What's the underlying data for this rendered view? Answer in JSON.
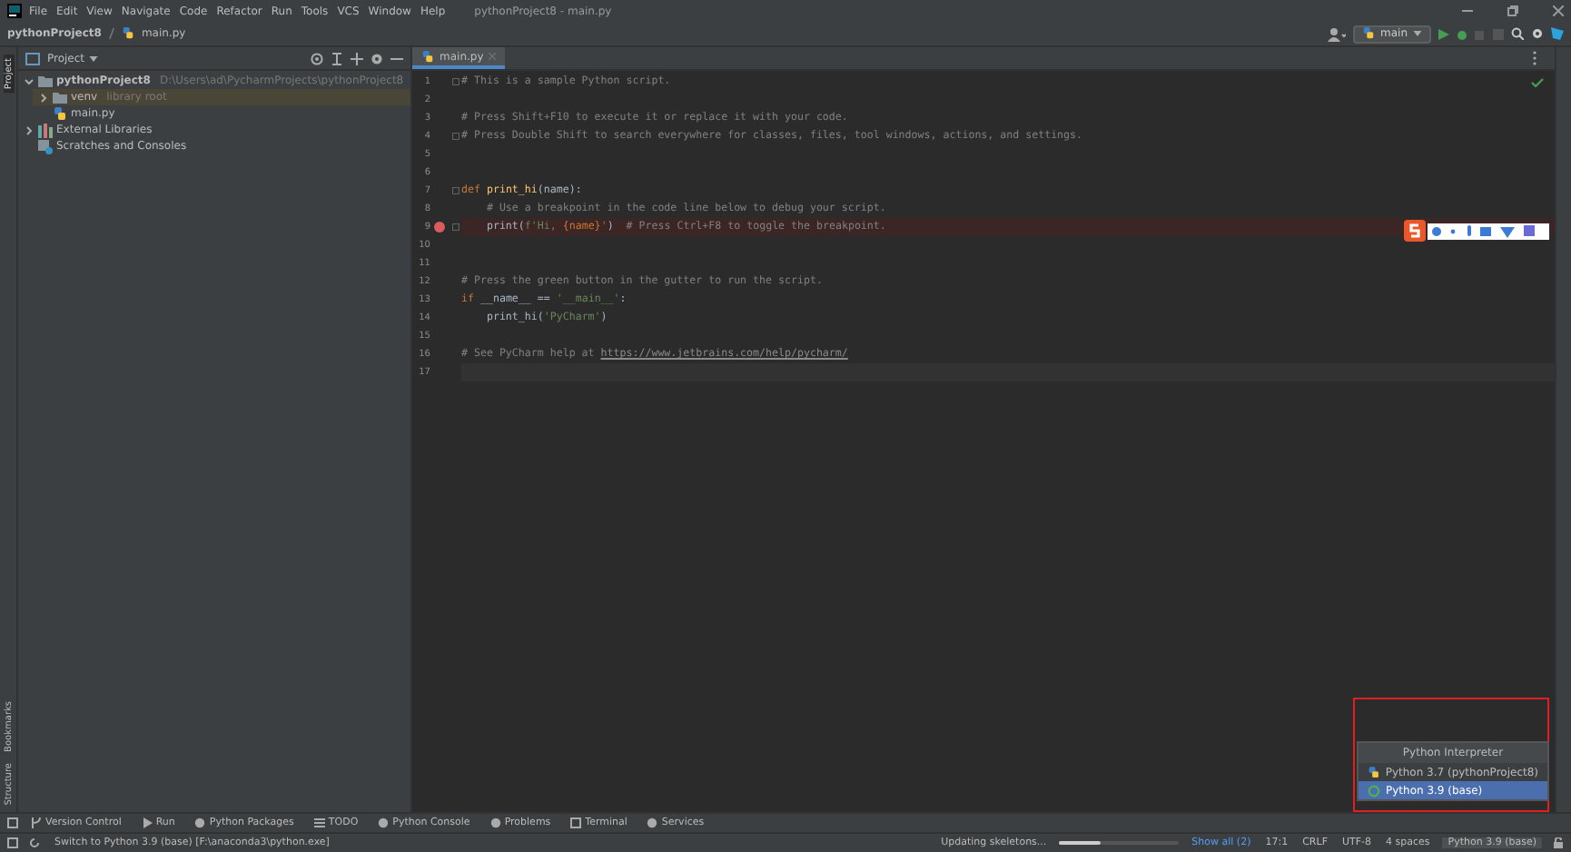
{
  "menu": [
    "File",
    "Edit",
    "View",
    "Navigate",
    "Code",
    "Refactor",
    "Run",
    "Tools",
    "VCS",
    "Window",
    "Help"
  ],
  "window_title": "pythonProject8 - main.py",
  "breadcrumb": [
    "pythonProject8",
    "main.py"
  ],
  "run_config": "main",
  "side_tabs": {
    "top": [
      {
        "label": "Project",
        "selected": true
      }
    ],
    "bottom": [
      {
        "label": "Bookmarks",
        "selected": false
      },
      {
        "label": "Structure",
        "selected": false
      }
    ]
  },
  "project_panel": {
    "title": "Project",
    "tree": [
      {
        "label": "pythonProject8",
        "hint": "D:\\Users\\ad\\PycharmProjects\\pythonProject8",
        "kind": "folder",
        "expanded": true,
        "selected": false,
        "children": [
          {
            "label": "venv",
            "hint": "library root",
            "kind": "folder",
            "expanded": false,
            "selected": true
          },
          {
            "label": "main.py",
            "kind": "python",
            "selected": false
          }
        ]
      },
      {
        "label": "External Libraries",
        "kind": "library",
        "expanded": false,
        "selected": false
      },
      {
        "label": "Scratches and Consoles",
        "kind": "scratch",
        "selected": false
      }
    ]
  },
  "editor": {
    "tab": "main.py",
    "lines": [
      {
        "number": "1",
        "fold": true,
        "tokens": [
          {
            "kind": "comment",
            "text": "# This is a sample Python script."
          }
        ]
      },
      {
        "number": "2"
      },
      {
        "number": "3",
        "tokens": [
          {
            "kind": "comment",
            "text": "# Press Shift+F10 to execute it or replace it with your code."
          }
        ]
      },
      {
        "number": "4",
        "fold": true,
        "tokens": [
          {
            "kind": "comment",
            "text": "# Press Double Shift to search everywhere for classes, files, tool windows, actions, and settings."
          }
        ]
      },
      {
        "number": "5"
      },
      {
        "number": "6"
      },
      {
        "number": "7",
        "fold": true,
        "tokens": [
          {
            "kind": "keyword",
            "text": "def "
          },
          {
            "kind": "fn",
            "text": "print_hi"
          },
          {
            "kind": "plain",
            "text": "(name):"
          }
        ]
      },
      {
        "number": "8",
        "tokens": [
          {
            "kind": "comment",
            "text": "    # Use a breakpoint in the code line below to debug your script."
          }
        ]
      },
      {
        "number": "9",
        "breakpoint": true,
        "fold": true,
        "tokens": [
          {
            "kind": "plain",
            "text": "    print("
          },
          {
            "kind": "str",
            "text": "f'Hi, "
          },
          {
            "kind": "keyword",
            "text": "{name}"
          },
          {
            "kind": "str",
            "text": "'"
          },
          {
            "kind": "plain",
            "text": ")  "
          },
          {
            "kind": "comment",
            "text": "# Press Ctrl+F8 to toggle the breakpoint."
          }
        ]
      },
      {
        "number": "10"
      },
      {
        "number": "11"
      },
      {
        "number": "12",
        "tokens": [
          {
            "kind": "comment",
            "text": "# Press the green button in the gutter to run the script."
          }
        ]
      },
      {
        "number": "13",
        "tokens": [
          {
            "kind": "keyword",
            "text": "if "
          },
          {
            "kind": "plain",
            "text": "__name__ == "
          },
          {
            "kind": "str",
            "text": "'__main__'"
          },
          {
            "kind": "plain",
            "text": ":"
          }
        ]
      },
      {
        "number": "14",
        "tokens": [
          {
            "kind": "plain",
            "text": "    print_hi("
          },
          {
            "kind": "str",
            "text": "'PyCharm'"
          },
          {
            "kind": "plain",
            "text": ")"
          }
        ]
      },
      {
        "number": "15"
      },
      {
        "number": "16",
        "tokens": [
          {
            "kind": "comment",
            "text": "# See PyCharm help at "
          },
          {
            "kind": "link",
            "text": "https://www.jetbrains.com/help/pycharm/"
          }
        ]
      },
      {
        "number": "17",
        "current": true
      }
    ]
  },
  "interpreter_popup": {
    "title": "Python Interpreter",
    "items": [
      {
        "label": "Python 3.7 (pythonProject8)",
        "kind": "venv",
        "selected": false
      },
      {
        "label": "Python 3.9 (base)",
        "kind": "conda",
        "selected": true
      }
    ]
  },
  "tool_windows": [
    "Version Control",
    "Run",
    "Python Packages",
    "TODO",
    "Python Console",
    "Problems",
    "Terminal",
    "Services"
  ],
  "status_bar": {
    "message": "Switch to Python 3.9 (base) [F:\\anaconda3\\python.exe]",
    "task": "Updating skeletons...",
    "level": 0.35,
    "show_all": "Show all (2)",
    "position": "17:1",
    "line_sep": "CRLF",
    "encoding": "UTF-8",
    "indent": "4 spaces",
    "interpreter": "Python 3.9 (base)"
  }
}
